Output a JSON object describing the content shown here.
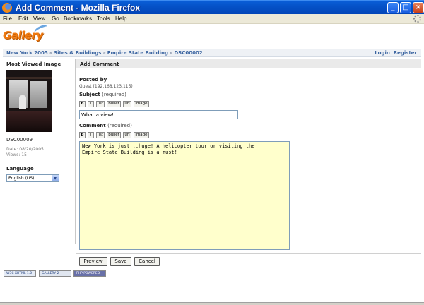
{
  "window": {
    "title": "Add Comment - Mozilla Firefox",
    "controls": [
      "_",
      "□",
      "×"
    ]
  },
  "menu": [
    "File",
    "Edit",
    "View",
    "Go",
    "Bookmarks",
    "Tools",
    "Help"
  ],
  "logo_text": "Gallery",
  "breadcrumb": [
    "New York 2005",
    "Sites & Buildings",
    "Empire State Building",
    "DSC00002"
  ],
  "breadcrumb_separator": "»",
  "auth": {
    "login": "Login",
    "register": "Register"
  },
  "sidebar": {
    "heading": "Most Viewed Image",
    "image_name": "DSC00009",
    "date": "Date: 08/20/2005",
    "views": "Views: 15",
    "language_heading": "Language",
    "language_selected": "English (US)"
  },
  "main": {
    "heading": "Add Comment",
    "posted_by_label": "Posted by",
    "posted_by_value": "Guest (192.168.123.115)",
    "subject_label": "Subject",
    "subject_required": "(required)",
    "subject_value": "What a view!",
    "comment_label": "Comment",
    "comment_required": "(required)",
    "comment_value": "New York is just...huge! A helicopter tour or visiting the\nEmpire State Building is a must!",
    "toolbar": [
      "B",
      "i",
      "list",
      "bullet",
      "url",
      "image"
    ]
  },
  "buttons": {
    "preview": "Preview",
    "save": "Save",
    "cancel": "Cancel"
  },
  "badges": {
    "w3c": "W3C XHTML 1.0",
    "gallery": "GALLERY 2",
    "php": "PHP POWERED"
  },
  "colors": {
    "titlebar": "#0552c8",
    "link": "#3a64a0",
    "comment_bg": "#ffffcc",
    "logo": "#f07a10"
  }
}
